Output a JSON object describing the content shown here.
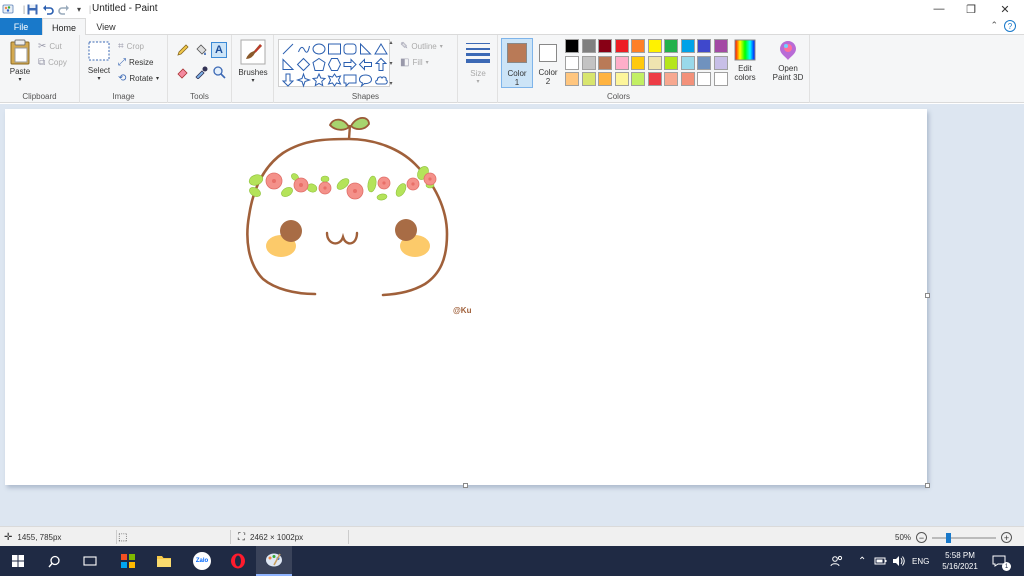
{
  "window": {
    "title": "Untitled - Paint",
    "minimize": "—",
    "maximize": "❐",
    "close": "✕"
  },
  "tabs": {
    "file": "File",
    "home": "Home",
    "view": "View"
  },
  "help": "?",
  "clipboard": {
    "paste": "Paste",
    "cut": "Cut",
    "copy": "Copy",
    "label": "Clipboard"
  },
  "image": {
    "select": "Select",
    "crop": "Crop",
    "resize": "Resize",
    "rotate": "Rotate",
    "label": "Image"
  },
  "tools": {
    "label": "Tools"
  },
  "brushes": {
    "label": "Brushes"
  },
  "shapes": {
    "outline": "Outline",
    "fill": "Fill",
    "label": "Shapes"
  },
  "size": {
    "label": "Size"
  },
  "colors": {
    "color1": "Color 1",
    "color1_line1": "Color",
    "color1_line2": "1",
    "color2_line1": "Color",
    "color2_line2": "2",
    "color1_value": "#b97a57",
    "color2_value": "#ffffff",
    "label": "Colors",
    "edit_line1": "Edit",
    "edit_line2": "colors",
    "paint3d_line1": "Open",
    "paint3d_line2": "Paint 3D",
    "palette_row1": [
      "#000000",
      "#7f7f7f",
      "#880015",
      "#ed1c24",
      "#ff7f27",
      "#fff200",
      "#22b14c",
      "#00a2e8",
      "#3f48cc",
      "#a349a4"
    ],
    "palette_row2": [
      "#ffffff",
      "#c3c3c3",
      "#b97a57",
      "#ffaec9",
      "#ffc90e",
      "#efe4b0",
      "#b5e61d",
      "#99d9ea",
      "#7092be",
      "#c8bfe7"
    ],
    "palette_row3": [
      "#ffc67f",
      "#d8e56e",
      "#ffb340",
      "#fdf59b",
      "#c2ef64",
      "#ed3c46",
      "#f7a890",
      "#f3917a",
      "#ffffff",
      "#ffffff"
    ]
  },
  "canvas": {
    "signature": "@Ku"
  },
  "status": {
    "cursor_pos": "1455, 785px",
    "image_size": "2462 × 1002px",
    "zoom": "50%"
  },
  "taskbar": {
    "language": "ENG",
    "time": "5:58 PM",
    "date": "5/16/2021",
    "notifications": "1",
    "zalo": "Zalo"
  }
}
